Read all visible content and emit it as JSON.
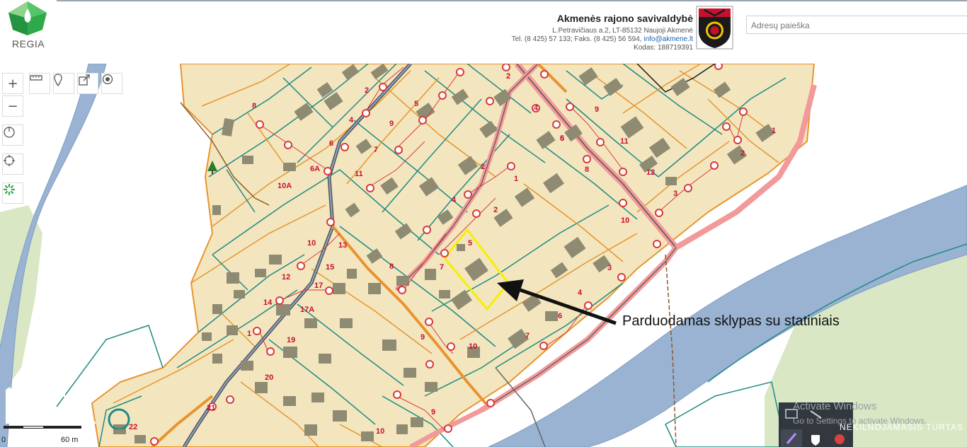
{
  "app": {
    "logo_text": "REGIA"
  },
  "municipality": {
    "name": "Akmenės rajono savivaldybė",
    "address": "L.Petravičiaus a.2, LT-85132 Naujoji Akmenė",
    "phone_prefix": "Tel. (8 425) 57 133; Faks. (8 425) 56 594,",
    "email": "info@akmene.lt",
    "code": "Kodas: 188719391"
  },
  "search": {
    "placeholder": "Adresų paieška"
  },
  "toolbar": [
    "plus-icon",
    "minus-icon",
    "ruler-icon",
    "pin-icon",
    "share-icon",
    "target-icon",
    "power-icon",
    "crosshair-icon",
    "spinner-icon"
  ],
  "map": {
    "annotation": "Parduodamas sklypas su statiniais",
    "scale_zero": "0",
    "scale_length": "60 m",
    "parcel_labels": [
      {
        "text": "8"
      },
      {
        "text": "2"
      },
      {
        "text": "4"
      },
      {
        "text": "6"
      },
      {
        "text": "6A"
      },
      {
        "text": "10A"
      },
      {
        "text": "11"
      },
      {
        "text": "7"
      },
      {
        "text": "9"
      },
      {
        "text": "5"
      },
      {
        "text": "2"
      },
      {
        "text": "2"
      },
      {
        "text": "4"
      },
      {
        "text": "9"
      },
      {
        "text": "11"
      },
      {
        "text": "12"
      },
      {
        "text": "1"
      },
      {
        "text": "2"
      },
      {
        "text": "3"
      },
      {
        "text": "10"
      },
      {
        "text": "6"
      },
      {
        "text": "8"
      },
      {
        "text": "1"
      },
      {
        "text": "2"
      },
      {
        "text": "3"
      },
      {
        "text": "4"
      },
      {
        "text": "5"
      },
      {
        "text": "7"
      },
      {
        "text": "10"
      },
      {
        "text": "13"
      },
      {
        "text": "15"
      },
      {
        "text": "12"
      },
      {
        "text": "17"
      },
      {
        "text": "14"
      },
      {
        "text": "17A"
      },
      {
        "text": "1"
      },
      {
        "text": "19"
      },
      {
        "text": "20"
      },
      {
        "text": "8"
      },
      {
        "text": "9"
      },
      {
        "text": "10"
      },
      {
        "text": "6"
      },
      {
        "text": "7"
      },
      {
        "text": "4"
      },
      {
        "text": "5"
      },
      {
        "text": "9"
      },
      {
        "text": "10"
      },
      {
        "text": "22"
      },
      {
        "text": "21"
      }
    ]
  },
  "os_overlay": {
    "activate_title": "Activate Windows",
    "activate_sub": "Go to Settings to activate Windows.",
    "watermark_sub": "NEKILNOJAMASIS TURTAS"
  },
  "colors": {
    "parcel_fill": "#f3e6bf",
    "parcel_border_teal": "#1f8a84",
    "parcel_border_orange": "#e8942e",
    "building": "#8f8b72",
    "river": "#9ab3d2",
    "river_edge": "#7e9dc4",
    "forest": "#d9e7c4",
    "road_pink": "#f29a9a",
    "road_dark": "#555555",
    "pipe_red": "#d83a3a",
    "label_red": "#c8102e",
    "highlight": "#f4f000"
  }
}
